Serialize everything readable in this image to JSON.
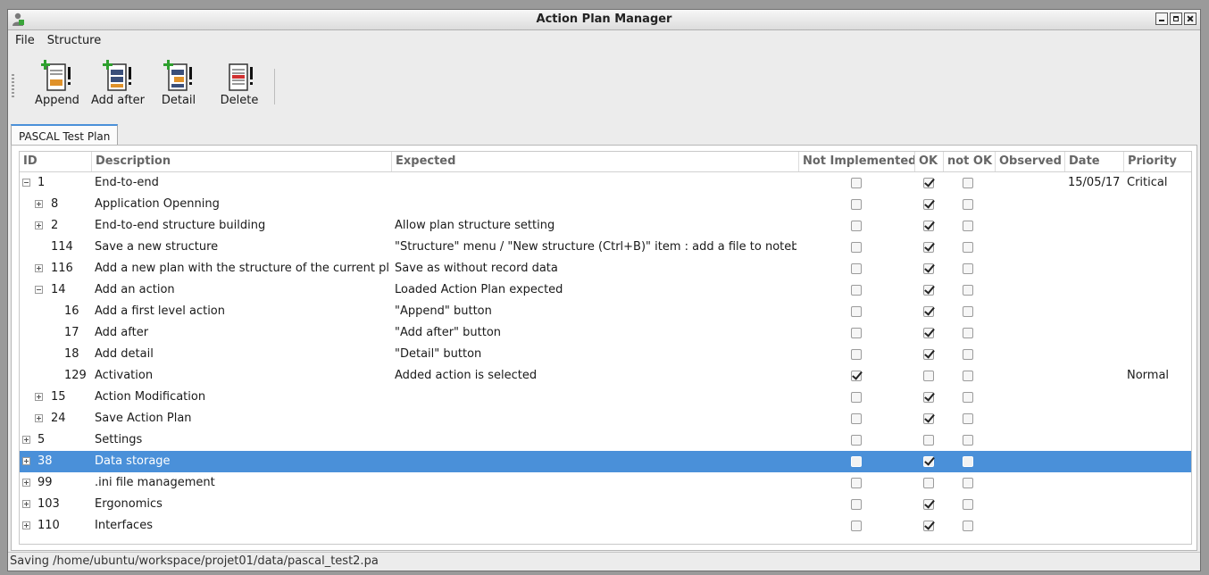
{
  "window": {
    "title": "Action Plan Manager"
  },
  "menu": {
    "file": "File",
    "structure": "Structure"
  },
  "toolbar": {
    "append": "Append",
    "add_after": "Add after",
    "detail": "Detail",
    "delete": "Delete"
  },
  "tabs": {
    "active": "PASCAL Test Plan"
  },
  "columns": {
    "id": "ID",
    "description": "Description",
    "expected": "Expected",
    "not_implemented": "Not Implemented",
    "ok": "OK",
    "not_ok": "not OK",
    "observed": "Observed",
    "date": "Date",
    "priority": "Priority"
  },
  "rows": [
    {
      "id": "1",
      "desc": "End-to-end",
      "expected": "",
      "ni": false,
      "ok": true,
      "nok": false,
      "observed": "",
      "date": "15/05/17",
      "priority": "Critical",
      "level": 0,
      "toggle": "minus",
      "selected": false
    },
    {
      "id": "8",
      "desc": "Application Openning",
      "expected": "",
      "ni": false,
      "ok": true,
      "nok": false,
      "observed": "",
      "date": "",
      "priority": "",
      "level": 1,
      "toggle": "plus",
      "selected": false
    },
    {
      "id": "2",
      "desc": "End-to-end structure building",
      "expected": "Allow plan structure setting",
      "ni": false,
      "ok": true,
      "nok": false,
      "observed": "",
      "date": "",
      "priority": "",
      "level": 1,
      "toggle": "plus",
      "selected": false
    },
    {
      "id": "114",
      "desc": "Save a new structure",
      "expected": "\"Structure\" menu / \"New structure (Ctrl+B)\" item : add a file to notebook",
      "ni": false,
      "ok": true,
      "nok": false,
      "observed": "",
      "date": "",
      "priority": "",
      "level": 1,
      "toggle": "none",
      "selected": false
    },
    {
      "id": "116",
      "desc": "Add a new plan with the structure of the current plan",
      "expected": "Save as without record data",
      "ni": false,
      "ok": true,
      "nok": false,
      "observed": "",
      "date": "",
      "priority": "",
      "level": 1,
      "toggle": "plus",
      "selected": false
    },
    {
      "id": "14",
      "desc": "Add an action",
      "expected": "Loaded Action Plan expected",
      "ni": false,
      "ok": true,
      "nok": false,
      "observed": "",
      "date": "",
      "priority": "",
      "level": 1,
      "toggle": "minus",
      "selected": false
    },
    {
      "id": "16",
      "desc": "Add a first level action",
      "expected": "\"Append\" button",
      "ni": false,
      "ok": true,
      "nok": false,
      "observed": "",
      "date": "",
      "priority": "",
      "level": 2,
      "toggle": "none",
      "selected": false
    },
    {
      "id": "17",
      "desc": "Add after",
      "expected": "\"Add after\" button",
      "ni": false,
      "ok": true,
      "nok": false,
      "observed": "",
      "date": "",
      "priority": "",
      "level": 2,
      "toggle": "none",
      "selected": false
    },
    {
      "id": "18",
      "desc": "Add detail",
      "expected": "\"Detail\" button",
      "ni": false,
      "ok": true,
      "nok": false,
      "observed": "",
      "date": "",
      "priority": "",
      "level": 2,
      "toggle": "none",
      "selected": false
    },
    {
      "id": "129",
      "desc": "Activation",
      "expected": "Added action is selected",
      "ni": true,
      "ok": false,
      "nok": false,
      "observed": "",
      "date": "",
      "priority": "Normal",
      "level": 2,
      "toggle": "none",
      "selected": false
    },
    {
      "id": "15",
      "desc": "Action Modification",
      "expected": "",
      "ni": false,
      "ok": true,
      "nok": false,
      "observed": "",
      "date": "",
      "priority": "",
      "level": 1,
      "toggle": "plus",
      "selected": false
    },
    {
      "id": "24",
      "desc": "Save Action Plan",
      "expected": "",
      "ni": false,
      "ok": true,
      "nok": false,
      "observed": "",
      "date": "",
      "priority": "",
      "level": 1,
      "toggle": "plus",
      "selected": false
    },
    {
      "id": "5",
      "desc": "Settings",
      "expected": "",
      "ni": false,
      "ok": false,
      "nok": false,
      "observed": "",
      "date": "",
      "priority": "",
      "level": 0,
      "toggle": "plus",
      "selected": false
    },
    {
      "id": "38",
      "desc": "Data storage",
      "expected": "",
      "ni": false,
      "ok": true,
      "nok": false,
      "observed": "",
      "date": "",
      "priority": "",
      "level": 0,
      "toggle": "plus",
      "selected": true
    },
    {
      "id": "99",
      "desc": ".ini file management",
      "expected": "",
      "ni": false,
      "ok": false,
      "nok": false,
      "observed": "",
      "date": "",
      "priority": "",
      "level": 0,
      "toggle": "plus",
      "selected": false
    },
    {
      "id": "103",
      "desc": "Ergonomics",
      "expected": "",
      "ni": false,
      "ok": true,
      "nok": false,
      "observed": "",
      "date": "",
      "priority": "",
      "level": 0,
      "toggle": "plus",
      "selected": false
    },
    {
      "id": "110",
      "desc": "Interfaces",
      "expected": "",
      "ni": false,
      "ok": true,
      "nok": false,
      "observed": "",
      "date": "",
      "priority": "",
      "level": 0,
      "toggle": "plus",
      "selected": false
    }
  ],
  "status": {
    "text": "Saving /home/ubuntu/workspace/projet01/data/pascal_test2.pa"
  },
  "colors": {
    "selection": "#4a90d9",
    "tab_accent": "#4a90d9",
    "add_icon": "#2ea02e",
    "delete_icon": "#d03030"
  }
}
